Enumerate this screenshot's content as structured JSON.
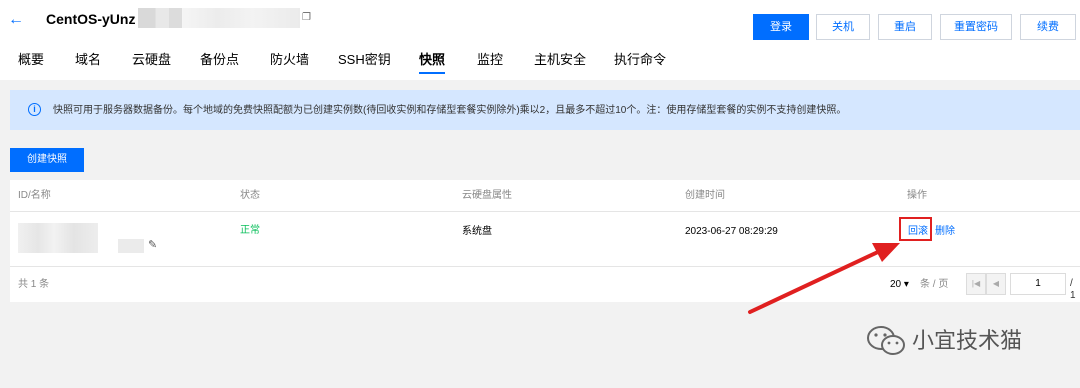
{
  "header": {
    "back_icon": "arrow-left-icon",
    "title": "CentOS-yUnz",
    "copy_icon": "copy-icon",
    "buttons": {
      "login": "登录",
      "shutdown": "关机",
      "restart": "重启",
      "reset_password": "重置密码",
      "renew": "续费"
    }
  },
  "tabs": [
    "概要",
    "域名",
    "云硬盘",
    "备份点",
    "防火墙",
    "SSH密钥",
    "快照",
    "监控",
    "主机安全",
    "执行命令"
  ],
  "active_tab": "快照",
  "notice": {
    "icon": "info-icon",
    "text": "快照可用于服务器数据备份。每个地域的免费快照配额为已创建实例数(待回收实例和存储型套餐实例除外)乘以2，且最多不超过10个。注：使用存储型套餐的实例不支持创建快照。"
  },
  "create_button": "创建快照",
  "table": {
    "columns": {
      "id_name": "ID/名称",
      "status": "状态",
      "disk_attr": "云硬盘属性",
      "created": "创建时间",
      "actions": "操作"
    },
    "rows": [
      {
        "status": "正常",
        "disk_attr": "系统盘",
        "created": "2023-06-27 08:29:29",
        "rollback": "回滚",
        "delete": "删除"
      }
    ],
    "footer": {
      "total": "共 1 条",
      "page_size": "20",
      "page_unit": "条 / 页",
      "page": "1",
      "pages": "/ 1"
    }
  },
  "colors": {
    "accent": "#006eff",
    "status_ok": "#0abf5b",
    "highlight": "#e02020",
    "notice_bg": "#d5e7ff"
  },
  "watermark": {
    "text": "小宜技术猫"
  }
}
